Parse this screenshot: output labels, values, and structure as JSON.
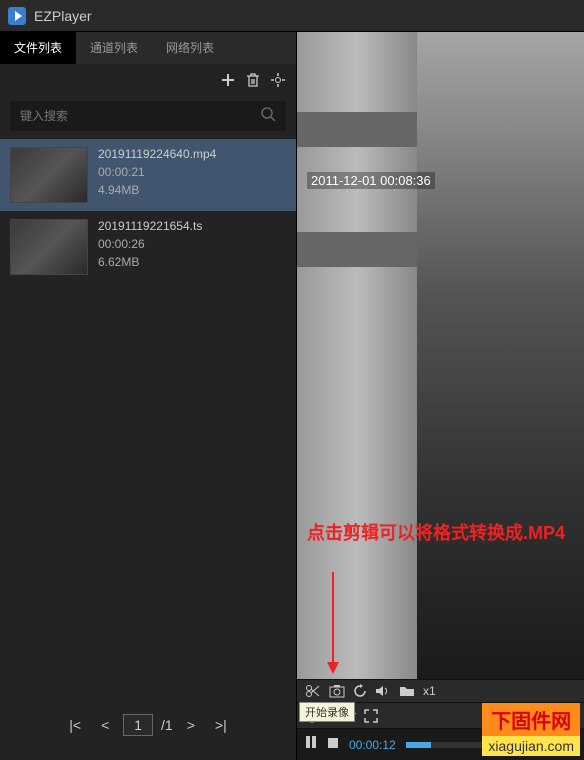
{
  "app": {
    "title": "EZPlayer"
  },
  "tabs": [
    {
      "label": "文件列表",
      "active": true
    },
    {
      "label": "通道列表",
      "active": false
    },
    {
      "label": "网络列表",
      "active": false
    }
  ],
  "search": {
    "placeholder": "键入搜索"
  },
  "files": [
    {
      "name": "20191119224640.mp4",
      "duration": "00:00:21",
      "size": "4.94MB",
      "selected": true
    },
    {
      "name": "20191119221654.ts",
      "duration": "00:00:26",
      "size": "6.62MB",
      "selected": false
    }
  ],
  "pagination": {
    "current": "1",
    "total": "/1"
  },
  "player": {
    "timestamp": "2011-12-01 00:08:36",
    "currentTime": "00:00:12",
    "speed": "x1",
    "tooltip": "开始录像"
  },
  "annotation": {
    "text": "点击剪辑可以将格式转换成.MP4"
  },
  "watermark": {
    "line1": "下固件网",
    "line2": "xiagujian.com"
  }
}
